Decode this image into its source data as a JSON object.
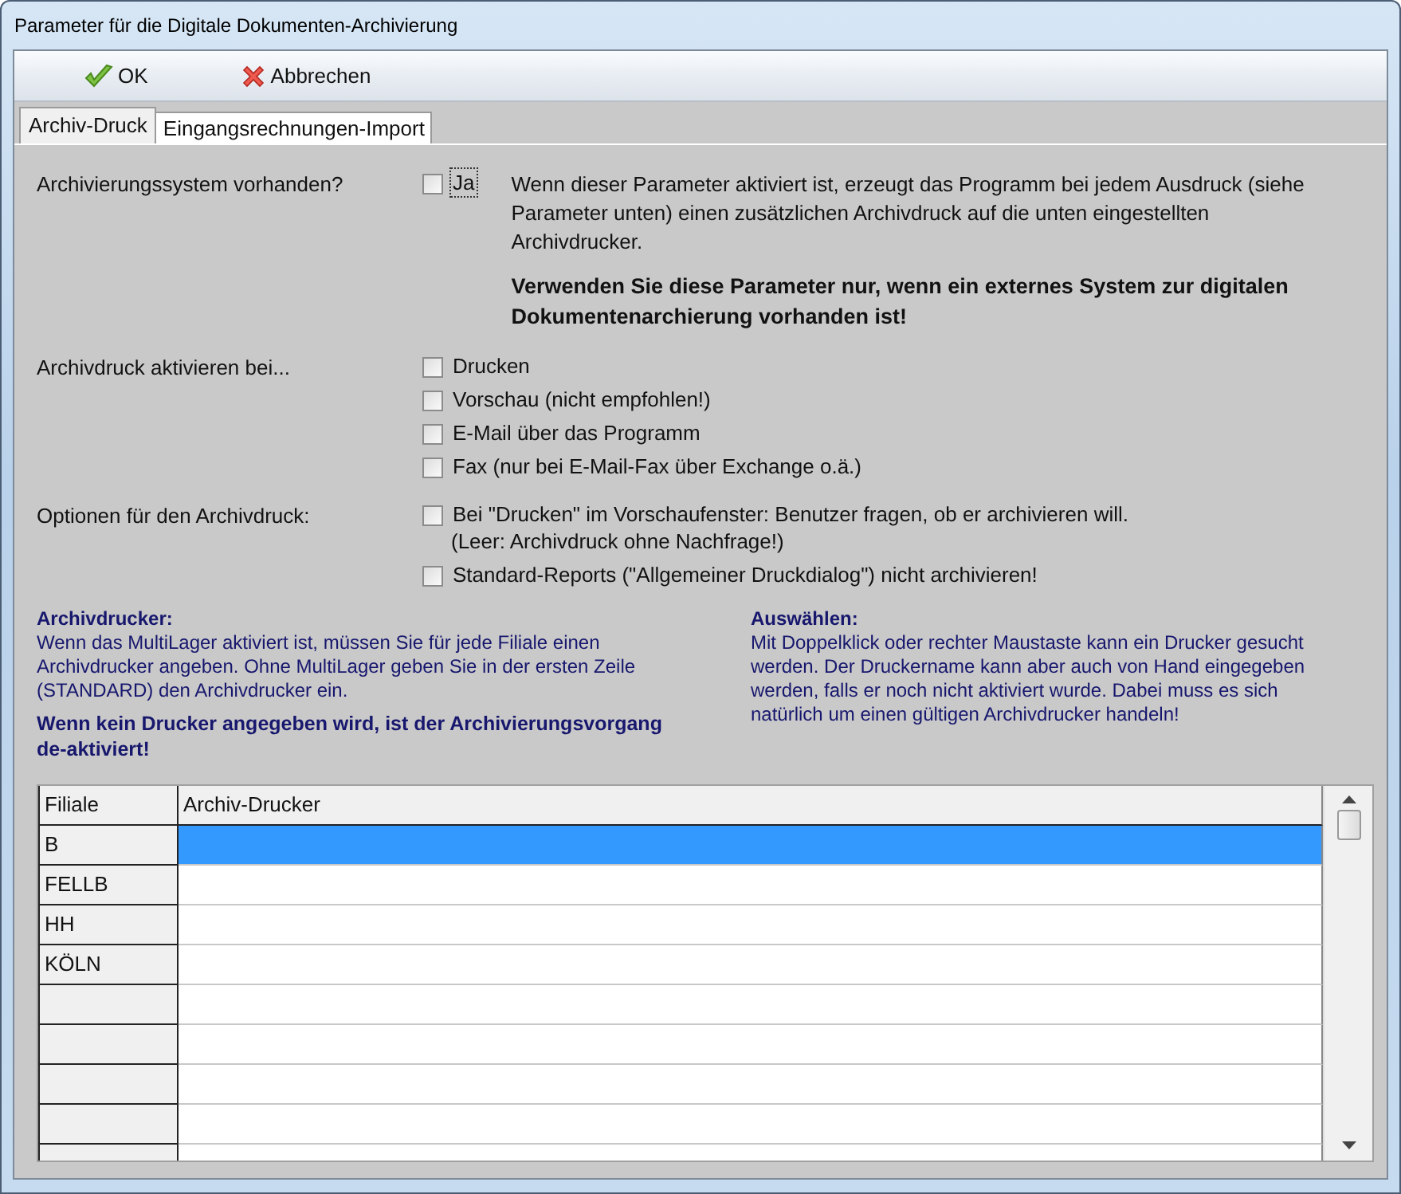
{
  "window": {
    "title": "Parameter für die Digitale Dokumenten-Archivierung"
  },
  "toolbar": [
    {
      "kind": "ok",
      "label": "OK"
    },
    {
      "kind": "cancel",
      "label": "Abbrechen"
    }
  ],
  "tabs": [
    {
      "label": "Archiv-Druck",
      "selected": true
    },
    {
      "label": "Eingangsrechnungen-Import",
      "selected": false
    }
  ],
  "settings": [
    {
      "label": "Archivierungssystem vorhanden?",
      "options": [
        {
          "label": "Ja",
          "checked": false,
          "focused": true
        }
      ],
      "description": "Wenn dieser Parameter aktiviert ist, erzeugt das Programm bei jedem Ausdruck (siehe Parameter unten) einen zusätzlichen Archivdruck auf die unten eingestellten Archivdrucker.",
      "warning": "Verwenden Sie diese Parameter nur, wenn ein externes System zur digitalen Dokumentenarchierung vorhanden ist!"
    },
    {
      "label": "Archivdruck aktivieren bei...",
      "options": [
        {
          "label": "Drucken",
          "checked": false
        },
        {
          "label": "Vorschau (nicht empfohlen!)",
          "checked": false
        },
        {
          "label": "E-Mail über das Programm",
          "checked": false
        },
        {
          "label": "Fax (nur bei E-Mail-Fax über Exchange o.ä.)",
          "checked": false
        }
      ]
    },
    {
      "label": "Optionen für den Archivdruck:",
      "options": [
        {
          "label": "Bei \"Drucken\" im Vorschaufenster: Benutzer fragen, ob er archivieren will.",
          "note": "(Leer: Archivdruck ohne Nachfrage!)",
          "checked": false
        },
        {
          "label": "Standard-Reports (\"Allgemeiner Druckdialog\") nicht archivieren!",
          "checked": false
        }
      ]
    }
  ],
  "info": [
    {
      "heading": "Archivdrucker:",
      "text": "Wenn das MultiLager aktiviert ist, müssen Sie für jede Filiale einen Archivdrucker angeben. Ohne MultiLager geben Sie in der ersten Zeile (STANDARD) den Archivdrucker ein.",
      "warning": "Wenn kein Drucker angegeben  wird, ist der Archivierungsvorgang de-aktiviert!"
    },
    {
      "heading": "Auswählen:",
      "text": "Mit Doppelklick oder rechter Maustaste kann ein Drucker gesucht werden. Der Druckername kann aber auch von Hand eingegeben werden, falls er noch nicht aktiviert wurde. Dabei muss es sich natürlich um einen gültigen Archivdrucker handeln!"
    }
  ],
  "table": {
    "columns": [
      "Filiale",
      "Archiv-Drucker"
    ],
    "rows": [
      {
        "filiale": "B",
        "selected": true
      },
      {
        "filiale": "FELLB",
        "selected": false
      },
      {
        "filiale": "HH",
        "selected": false
      },
      {
        "filiale": "KÖLN",
        "selected": false
      },
      {
        "selected": false
      },
      {
        "selected": false
      },
      {
        "selected": false
      },
      {
        "selected": false
      },
      {
        "selected": false
      }
    ]
  }
}
